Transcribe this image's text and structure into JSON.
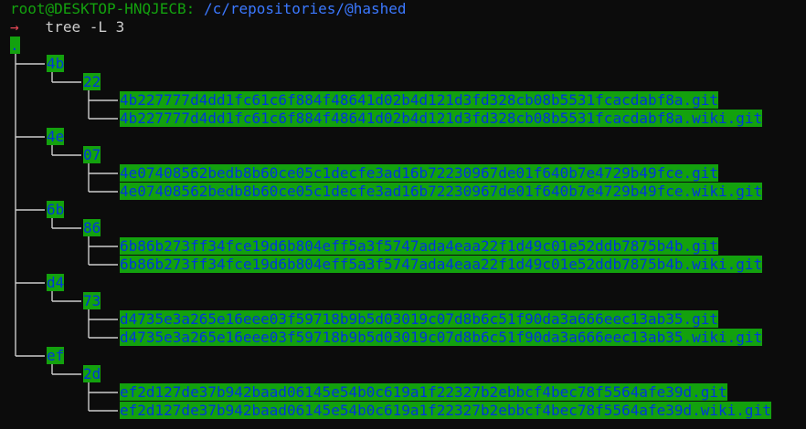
{
  "prompt": {
    "user_host": "root@DESKTOP-HNQJECB:",
    "cwd": "/c/repositories/@hashed",
    "arrow": "→",
    "command": "tree -L 3"
  },
  "tree": {
    "root": ".",
    "groups": [
      {
        "name": "4b",
        "sub": "22",
        "files": [
          "4b227777d4dd1fc61c6f884f48641d02b4d121d3fd328cb08b5531fcacdabf8a.git",
          "4b227777d4dd1fc61c6f884f48641d02b4d121d3fd328cb08b5531fcacdabf8a.wiki.git"
        ]
      },
      {
        "name": "4e",
        "sub": "07",
        "files": [
          "4e07408562bedb8b60ce05c1decfe3ad16b72230967de01f640b7e4729b49fce.git",
          "4e07408562bedb8b60ce05c1decfe3ad16b72230967de01f640b7e4729b49fce.wiki.git"
        ]
      },
      {
        "name": "6b",
        "sub": "86",
        "files": [
          "6b86b273ff34fce19d6b804eff5a3f5747ada4eaa22f1d49c01e52ddb7875b4b.git",
          "6b86b273ff34fce19d6b804eff5a3f5747ada4eaa22f1d49c01e52ddb7875b4b.wiki.git"
        ]
      },
      {
        "name": "d4",
        "sub": "73",
        "files": [
          "d4735e3a265e16eee03f59718b9b5d03019c07d8b6c51f90da3a666eec13ab35.git",
          "d4735e3a265e16eee03f59718b9b5d03019c07d8b6c51f90da3a666eec13ab35.wiki.git"
        ]
      },
      {
        "name": "ef",
        "sub": "2d",
        "files": [
          "ef2d127de37b942baad06145e54b0c619a1f22327b2ebbcf4bec78f5564afe39d.git",
          "ef2d127de37b942baad06145e54b0c619a1f22327b2ebbcf4bec78f5564afe39d.wiki.git"
        ]
      }
    ]
  },
  "colors": {
    "background": "#0c0c0c",
    "prompt_user": "#13a10e",
    "prompt_path": "#3b78ff",
    "arrow": "#e74856",
    "highlight_bg": "#13a10e",
    "highlight_fg": "#0037da",
    "tree_lines": "#cccccc"
  }
}
